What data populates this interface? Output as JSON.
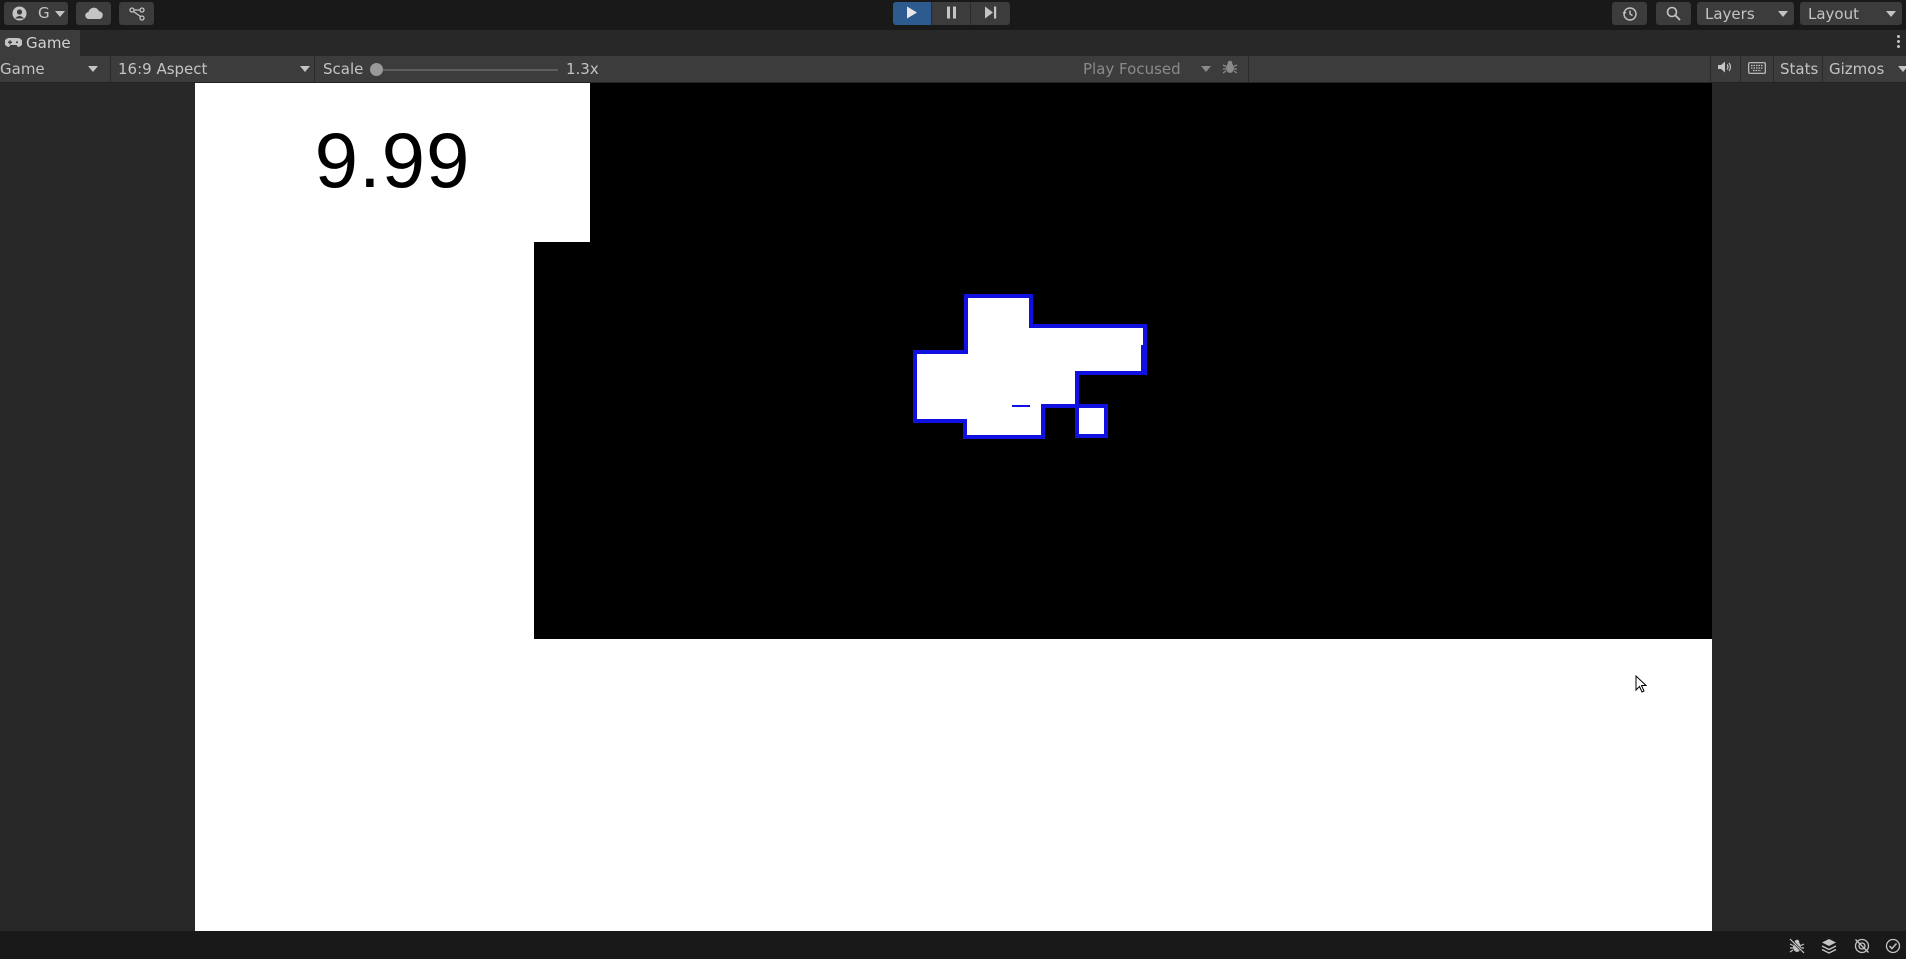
{
  "toolbar": {
    "account_label": "G",
    "layers_label": "Layers",
    "layout_label": "Layout"
  },
  "tab": {
    "title": "Game"
  },
  "gamebar": {
    "display_mode": "Game",
    "aspect": "16:9 Aspect",
    "scale_label": "Scale",
    "scale_value": "1.3x",
    "scale_fraction": 0.0,
    "play_focused": "Play Focused",
    "stats_label": "Stats",
    "gizmos_label": "Gizmos"
  },
  "game": {
    "score": "9.99",
    "shape_fill": "#ffffff",
    "shape_outline": "#1010e0"
  },
  "colors": {
    "play_active": "#2e5b8f",
    "background": "#191919",
    "panel": "#3c3c3c"
  }
}
